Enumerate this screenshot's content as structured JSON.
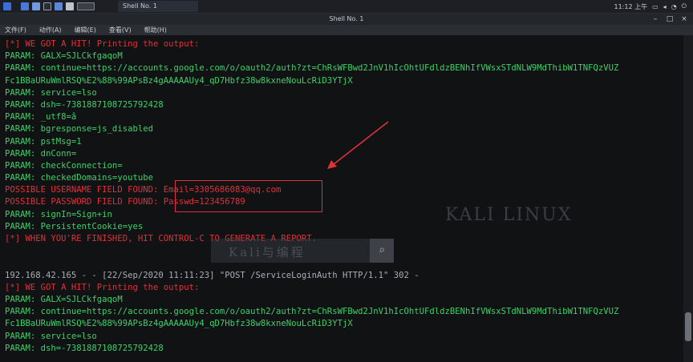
{
  "taskbar": {
    "task_label": "Shell No. 1",
    "clock": "11:12 上午"
  },
  "window": {
    "title": "Shell No. 1",
    "minimize": "–",
    "maximize": "□",
    "close": "×"
  },
  "menu": {
    "items": [
      "文件(F)",
      "动作(A)",
      "编辑(E)",
      "查看(V)",
      "帮助(H)"
    ]
  },
  "terminal": {
    "lines": [
      {
        "text": "[*] WE GOT A HIT! Printing the output:",
        "style": "red"
      },
      {
        "text": "PARAM: GALX=SJLCkfgaqoM",
        "style": "green"
      },
      {
        "text": "PARAM: continue=https://accounts.google.com/o/oauth2/auth?zt=ChRsWFBwd2JnV1hIcOhtUFdldzBENhIfVWsxSTdNLW9MdThibW1TNFQzVUZ",
        "style": "green"
      },
      {
        "text": "Fc1BBaURuWmlRSQ%E2%88%99APsBz4gAAAAAUy4_qD7Hbfz38w8kxneNouLcRiD3YTjX",
        "style": "green"
      },
      {
        "text": "PARAM: service=lso",
        "style": "green"
      },
      {
        "text": "PARAM: dsh=-7381887108725792428",
        "style": "green"
      },
      {
        "text": "PARAM: _utf8=â",
        "style": "green"
      },
      {
        "text": "PARAM: bgresponse=js_disabled",
        "style": "green"
      },
      {
        "text": "PARAM: pstMsg=1",
        "style": "green"
      },
      {
        "text": "PARAM: dnConn=",
        "style": "green"
      },
      {
        "text": "PARAM: checkConnection=",
        "style": "green"
      },
      {
        "text": "PARAM: checkedDomains=youtube",
        "style": "green"
      },
      {
        "text": "POSSIBLE USERNAME FIELD FOUND: Email=3305686083@qq.com",
        "style": "red"
      },
      {
        "text": "POSSIBLE PASSWORD FIELD FOUND: Passwd=123456789",
        "style": "red"
      },
      {
        "text": "PARAM: signIn=Sign+in",
        "style": "green"
      },
      {
        "text": "PARAM: PersistentCookie=yes",
        "style": "green"
      },
      {
        "text": "[*] WHEN YOU'RE FINISHED, HIT CONTROL-C TO GENERATE A REPORT.",
        "style": "red"
      },
      {
        "text": "",
        "style": "green"
      },
      {
        "text": "",
        "style": "green"
      },
      {
        "text": "192.168.42.165 - - [22/Sep/2020 11:11:23] \"POST /ServiceLoginAuth HTTP/1.1\" 302 -",
        "style": "grey"
      },
      {
        "text": "[*] WE GOT A HIT! Printing the output:",
        "style": "red"
      },
      {
        "text": "PARAM: GALX=SJLCkfgaqoM",
        "style": "green"
      },
      {
        "text": "PARAM: continue=https://accounts.google.com/o/oauth2/auth?zt=ChRsWFBwd2JnV1hIcOhtUFdldzBENhIfVWsxSTdNLW9MdThibW1TNFQzVUZ",
        "style": "green"
      },
      {
        "text": "Fc1BBaURuWmlRSQ%E2%88%99APsBz4gAAAAAUy4_qD7Hbfz38w8kxneNouLcRiD3YTjX",
        "style": "green"
      },
      {
        "text": "PARAM: service=lso",
        "style": "green"
      },
      {
        "text": "PARAM: dsh=-7381887108725792428",
        "style": "green"
      }
    ]
  },
  "watermark": {
    "brand": "KALI LINUX",
    "search_text": "Kali与编程"
  },
  "colors": {
    "green": "#3fd06a",
    "red": "#e0313a",
    "grey": "#a9aeb5",
    "background": "#101214"
  }
}
